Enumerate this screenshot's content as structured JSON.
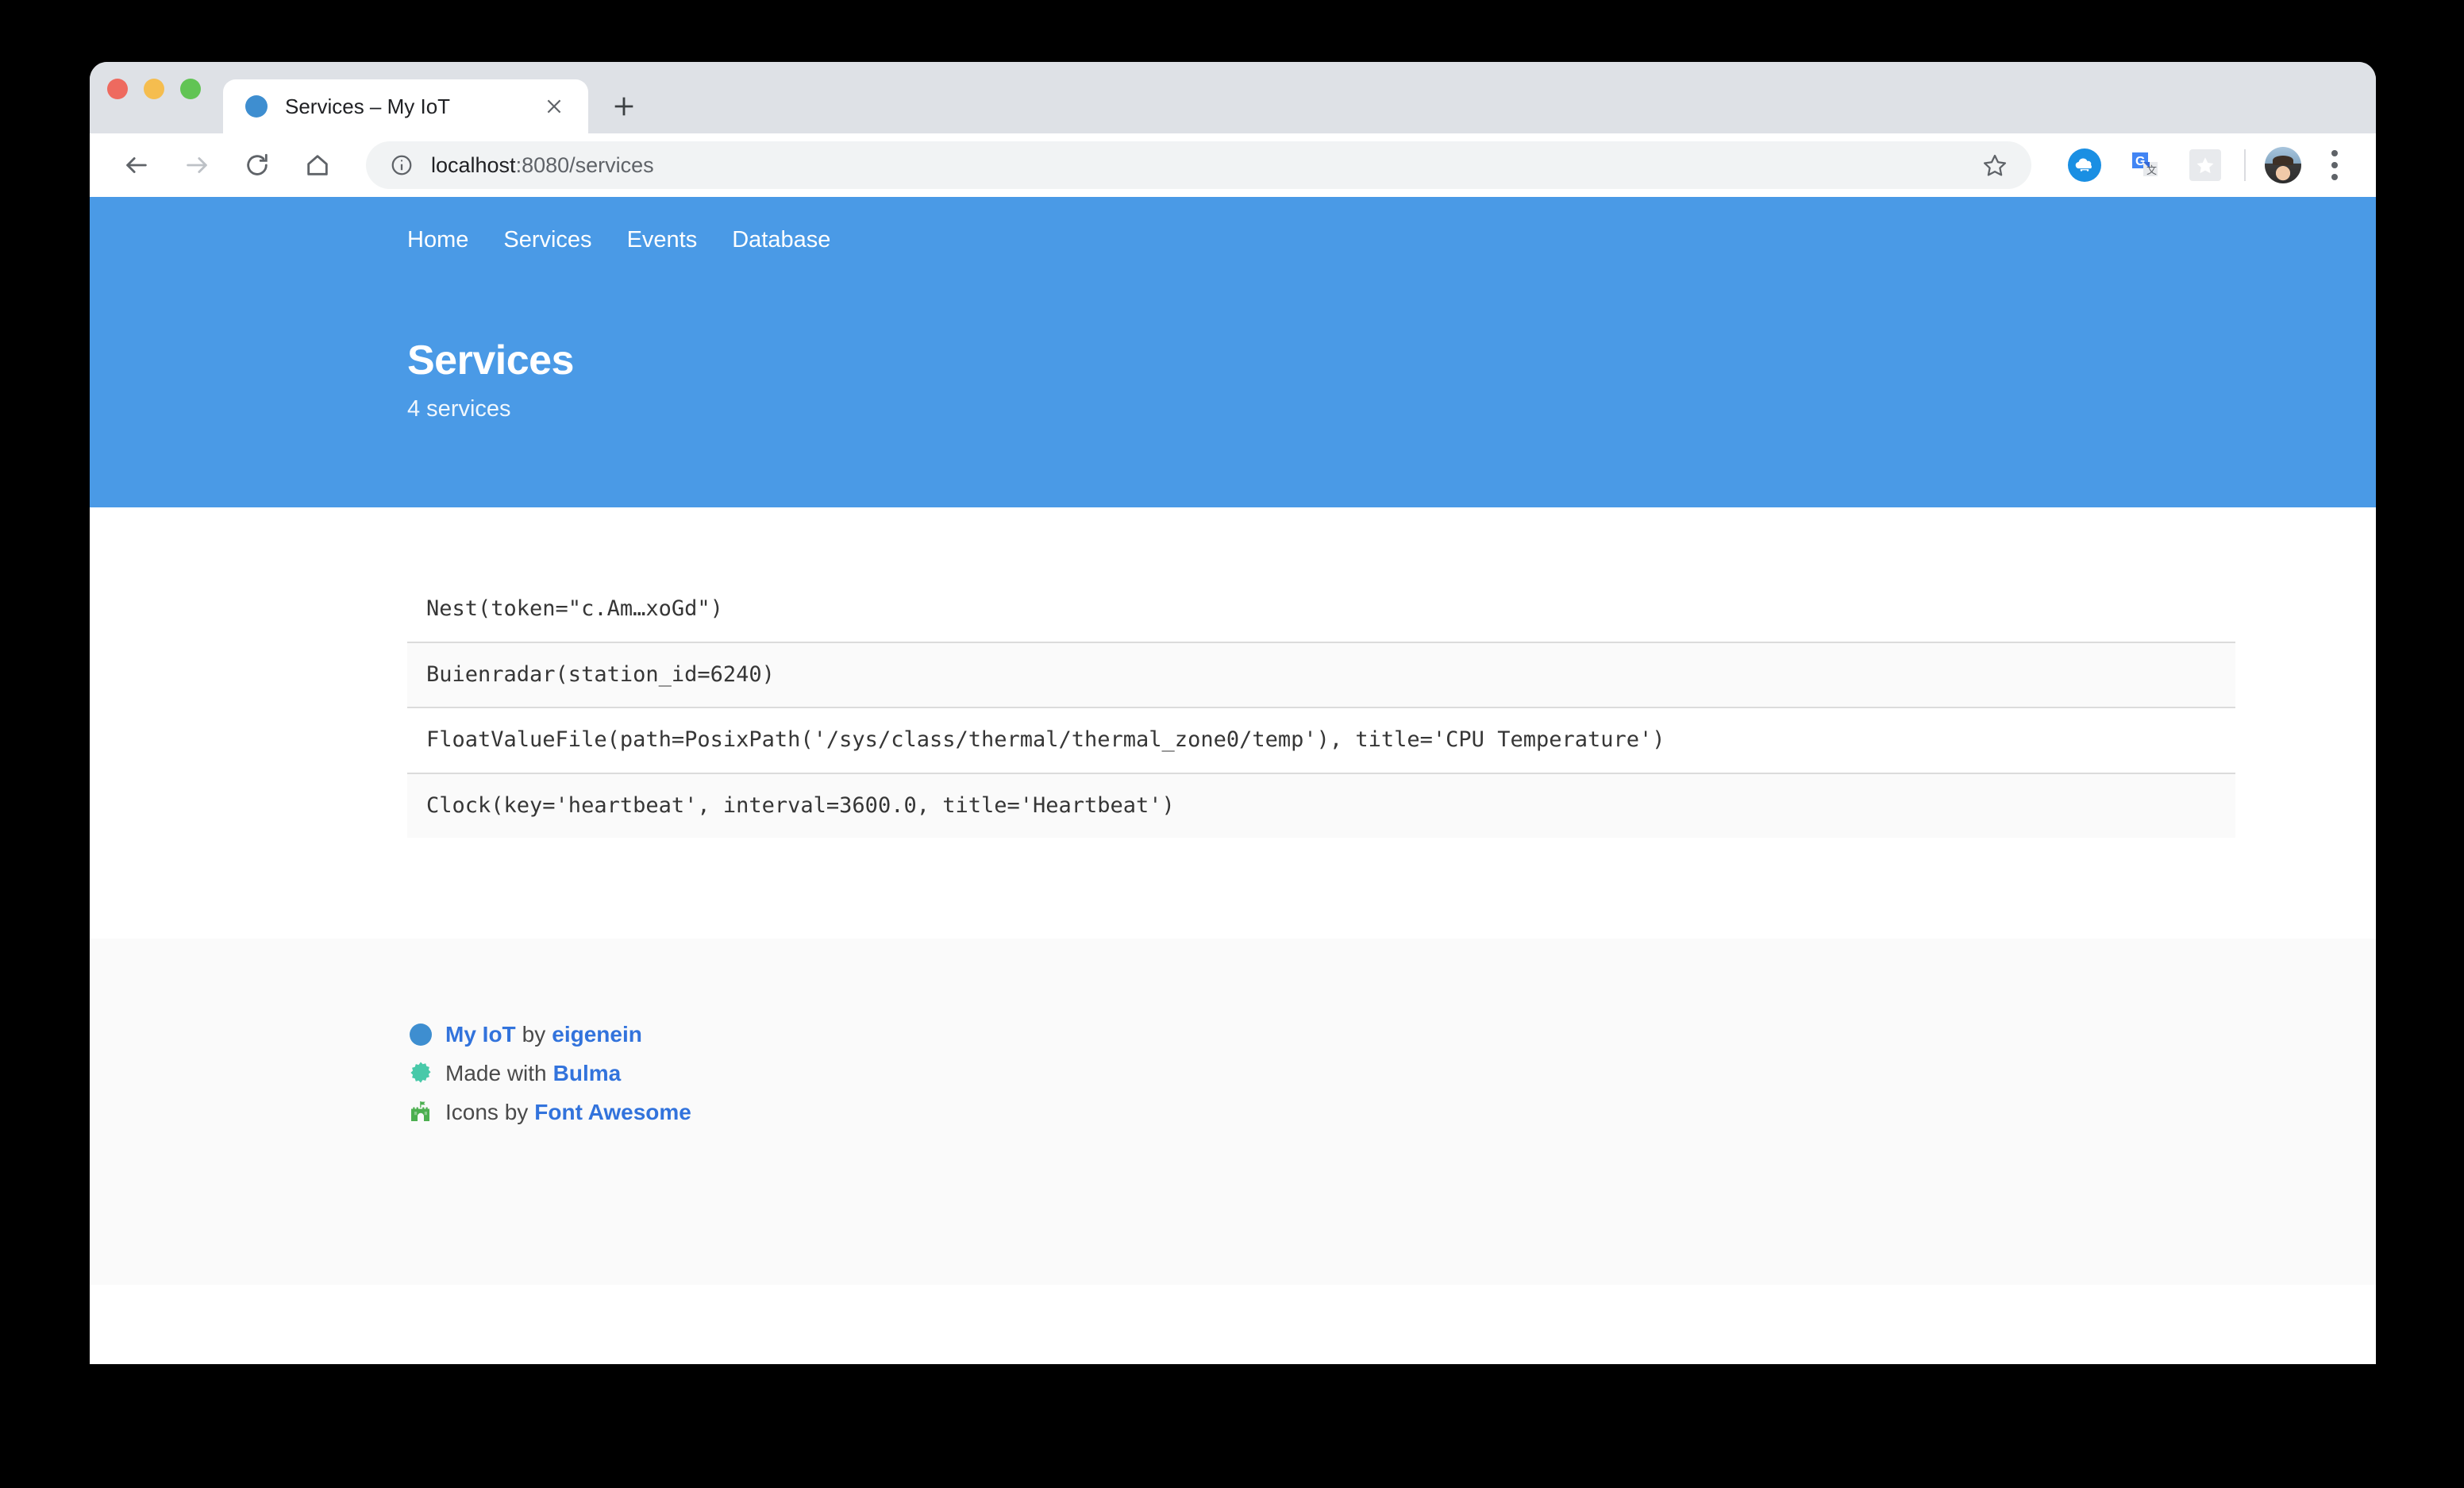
{
  "window": {
    "chrome_color": "#dee1e6",
    "traffic_lights": [
      "close",
      "minimize",
      "maximize"
    ]
  },
  "tab": {
    "title": "Services – My IoT",
    "favicon": "blue-circle-icon",
    "close_icon": "close-icon",
    "new_tab_icon": "plus-icon"
  },
  "toolbar": {
    "back_icon": "back-arrow-icon",
    "forward_icon": "forward-arrow-icon",
    "reload_icon": "reload-icon",
    "home_icon": "home-icon",
    "info_icon": "info-circle-icon",
    "url_host": "localhost",
    "url_path": ":8080/services",
    "bookmark_icon": "star-outline-icon",
    "extensions": [
      "cloud-car-icon",
      "google-translate-icon",
      "gray-star-icon"
    ],
    "avatar": "profile-avatar",
    "menu_icon": "three-dot-menu-icon"
  },
  "page": {
    "nav": {
      "items": [
        {
          "label": "Home"
        },
        {
          "label": "Services"
        },
        {
          "label": "Events"
        },
        {
          "label": "Database"
        }
      ]
    },
    "hero": {
      "title": "Services",
      "subtitle": "4 services",
      "background": "#4a9ae6"
    },
    "services": {
      "rows": [
        {
          "repr": "Nest(token=\"c.Am…xoGd\")"
        },
        {
          "repr": "Buienradar(station_id=6240)"
        },
        {
          "repr": "FloatValueFile(path=PosixPath('/sys/class/thermal/thermal_zone0/temp'), title='CPU Temperature')"
        },
        {
          "repr": "Clock(key='heartbeat', interval=3600.0, title='Heartbeat')"
        }
      ]
    },
    "footer": {
      "lines": [
        {
          "icon": "blue-circle-icon",
          "link1": "My IoT",
          "mid": "by",
          "link2": "eigenein"
        },
        {
          "icon": "certificate-icon",
          "link1": "",
          "mid": "Made with",
          "link2": "Bulma"
        },
        {
          "icon": "fort-awesome-castle-icon",
          "link1": "",
          "mid": "Icons by",
          "link2": "Font Awesome"
        }
      ]
    }
  }
}
